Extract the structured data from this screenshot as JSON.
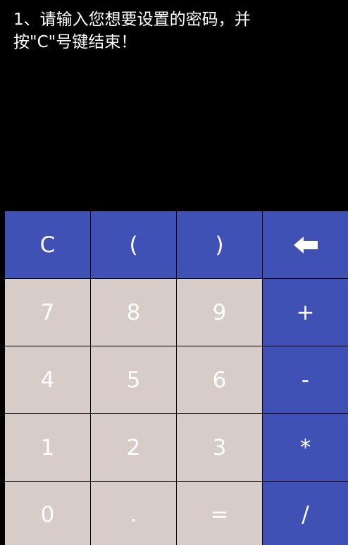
{
  "instruction": "1、请输入您想要设置的密码，并\n按\"C\"号键结束！",
  "keys": {
    "clear": "C",
    "open_paren": "(",
    "close_paren": ")",
    "backspace_icon": "backspace-arrow-icon",
    "seven": "7",
    "eight": "8",
    "nine": "9",
    "plus": "+",
    "four": "4",
    "five": "5",
    "six": "6",
    "minus": "-",
    "one": "1",
    "two": "2",
    "three": "3",
    "multiply": "*",
    "zero": "0",
    "dot": ".",
    "equals": "=",
    "divide": "/"
  },
  "colors": {
    "operator_key": "#3f51b5",
    "digit_key": "#d7ccc8",
    "background": "#000000",
    "key_text": "#ffffff"
  }
}
